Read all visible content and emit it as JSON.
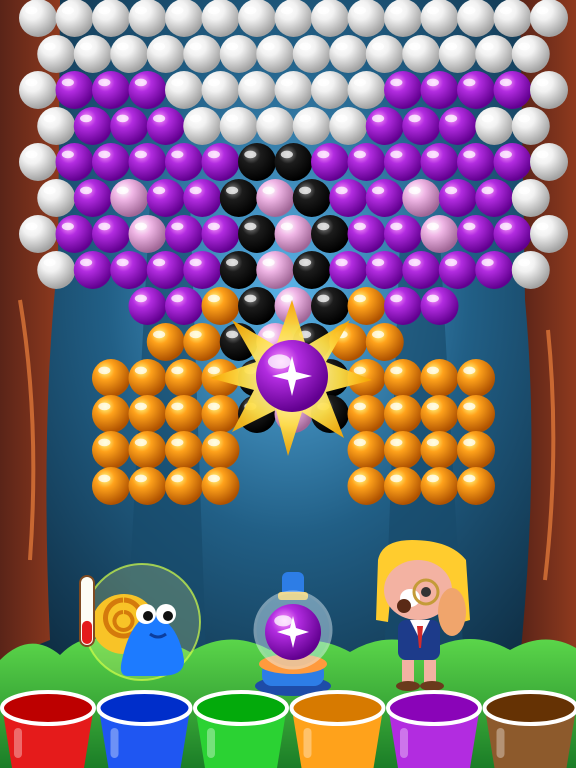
{
  "game": {
    "title": "",
    "colors": {
      "white": "#f2f2f2",
      "purple": "#b22ce0",
      "pink": "#f0b6e6",
      "black": "#1c1c1c",
      "orange": "#ffa21b",
      "red": "#e51b1b",
      "blue": "#1f56f2",
      "green": "#2bd233",
      "brown": "#8d5a2c"
    },
    "grid_rows": [
      [
        "white",
        "white",
        "white",
        "white",
        "white",
        "white",
        "white",
        "white",
        "white",
        "white",
        "white",
        "white",
        "white",
        "white",
        "white"
      ],
      [
        "white",
        "white",
        "white",
        "white",
        "white",
        "white",
        "white",
        "white",
        "white",
        "white",
        "white",
        "white",
        "white",
        "white"
      ],
      [
        "white",
        "purple",
        "purple",
        "purple",
        "white",
        "white",
        "white",
        "white",
        "white",
        "white",
        "purple",
        "purple",
        "purple",
        "purple",
        "white"
      ],
      [
        "white",
        "purple",
        "purple",
        "purple",
        "white",
        "white",
        "white",
        "white",
        "white",
        "purple",
        "purple",
        "purple",
        "white",
        "white"
      ],
      [
        "white",
        "purple",
        "purple",
        "purple",
        "purple",
        "purple",
        "black",
        "black",
        "purple",
        "purple",
        "purple",
        "purple",
        "purple",
        "purple",
        "white"
      ],
      [
        "white",
        "purple",
        "pink",
        "purple",
        "purple",
        "black",
        "pink",
        "black",
        "purple",
        "purple",
        "pink",
        "purple",
        "purple",
        "white"
      ],
      [
        "white",
        "purple",
        "purple",
        "pink",
        "purple",
        "purple",
        "black",
        "pink",
        "black",
        "purple",
        "purple",
        "pink",
        "purple",
        "purple",
        "white"
      ],
      [
        "white",
        "purple",
        "purple",
        "purple",
        "purple",
        "black",
        "pink",
        "black",
        "purple",
        "purple",
        "purple",
        "purple",
        "purple",
        "white"
      ],
      [
        "",
        "",
        "",
        "purple",
        "purple",
        "orange",
        "black",
        "pink",
        "black",
        "orange",
        "purple",
        "purple",
        "",
        "",
        ""
      ],
      [
        "",
        "",
        "",
        "orange",
        "orange",
        "black",
        "pink",
        "black",
        "orange",
        "orange",
        "",
        "",
        "",
        ""
      ],
      [
        "",
        "",
        "orange",
        "orange",
        "orange",
        "orange",
        "black",
        "pink",
        "black",
        "orange",
        "orange",
        "orange",
        "orange",
        "",
        ""
      ],
      [
        "",
        "",
        "orange",
        "orange",
        "orange",
        "orange",
        "black",
        "pink",
        "black",
        "orange",
        "orange",
        "orange",
        "orange",
        "",
        ""
      ],
      [
        "",
        "",
        "orange",
        "orange",
        "orange",
        "orange",
        "",
        "",
        "",
        "orange",
        "orange",
        "orange",
        "orange",
        "",
        ""
      ],
      [
        "",
        "",
        "orange",
        "orange",
        "orange",
        "orange",
        "",
        "",
        "",
        "orange",
        "orange",
        "orange",
        "orange",
        "",
        ""
      ]
    ],
    "active_bubble": {
      "color": "purple",
      "effect": "spark-burst"
    },
    "shooter": {
      "loaded_color": "purple"
    },
    "power_meter": {
      "fill_fraction": 0.35
    },
    "cups": [
      {
        "name": "red",
        "color": "red"
      },
      {
        "name": "blue",
        "color": "blue"
      },
      {
        "name": "green",
        "color": "green"
      },
      {
        "name": "orange",
        "color": "orange"
      },
      {
        "name": "purple",
        "color": "purple"
      },
      {
        "name": "brown",
        "color": "brown"
      }
    ]
  }
}
